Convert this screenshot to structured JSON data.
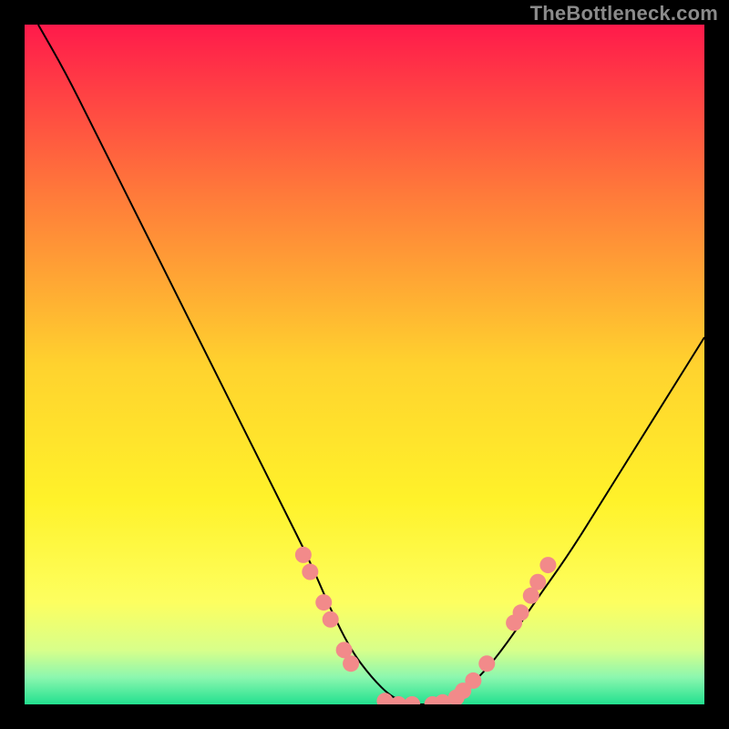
{
  "watermark": "TheBottleneck.com",
  "chart_data": {
    "type": "line",
    "title": "",
    "xlabel": "",
    "ylabel": "",
    "xlim": [
      0,
      100
    ],
    "ylim": [
      0,
      100
    ],
    "grid": false,
    "legend": false,
    "background_gradient": {
      "stops": [
        {
          "t": 0.0,
          "color": "#ff1a4b"
        },
        {
          "t": 0.25,
          "color": "#ff7a3a"
        },
        {
          "t": 0.5,
          "color": "#ffd22e"
        },
        {
          "t": 0.7,
          "color": "#fff22a"
        },
        {
          "t": 0.85,
          "color": "#fdff60"
        },
        {
          "t": 0.92,
          "color": "#d8ff8a"
        },
        {
          "t": 0.96,
          "color": "#8cf7af"
        },
        {
          "t": 1.0,
          "color": "#22e08f"
        }
      ]
    },
    "series": [
      {
        "name": "bottleneck-curve",
        "color": "#000000",
        "x": [
          2,
          6,
          10,
          14,
          18,
          22,
          26,
          30,
          34,
          38,
          42,
          45,
          48,
          51,
          54,
          57,
          60,
          63,
          67,
          71,
          75,
          80,
          85,
          90,
          95,
          100
        ],
        "y": [
          100,
          93,
          85,
          77,
          69,
          61,
          53,
          45,
          37,
          29,
          21,
          14,
          8,
          4,
          1,
          0,
          0,
          1,
          4,
          9,
          15,
          22,
          30,
          38,
          46,
          54
        ]
      }
    ],
    "markers": {
      "name": "highlighted-points",
      "color": "#f28a8a",
      "radius": 9,
      "points": [
        {
          "x": 41,
          "y": 22
        },
        {
          "x": 42,
          "y": 19.5
        },
        {
          "x": 44,
          "y": 15
        },
        {
          "x": 45,
          "y": 12.5
        },
        {
          "x": 47,
          "y": 8
        },
        {
          "x": 48,
          "y": 6
        },
        {
          "x": 53,
          "y": 0.5
        },
        {
          "x": 55,
          "y": 0
        },
        {
          "x": 57,
          "y": 0
        },
        {
          "x": 60,
          "y": 0
        },
        {
          "x": 61.5,
          "y": 0.3
        },
        {
          "x": 63.5,
          "y": 1
        },
        {
          "x": 64.5,
          "y": 2
        },
        {
          "x": 66,
          "y": 3.5
        },
        {
          "x": 68,
          "y": 6
        },
        {
          "x": 72,
          "y": 12
        },
        {
          "x": 73,
          "y": 13.5
        },
        {
          "x": 74.5,
          "y": 16
        },
        {
          "x": 75.5,
          "y": 18
        },
        {
          "x": 77,
          "y": 20.5
        }
      ]
    }
  }
}
